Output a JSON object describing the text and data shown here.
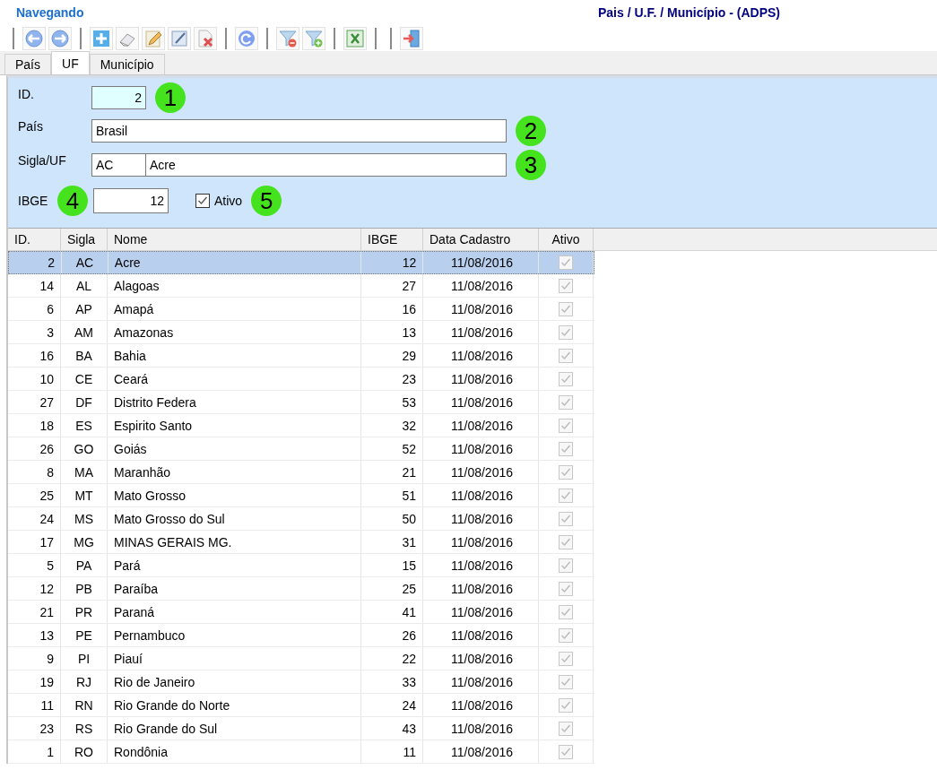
{
  "header": {
    "mode": "Navegando",
    "title": "Pais / U.F. / Município - (ADPS)"
  },
  "tabs": [
    {
      "label": "País",
      "selected": false
    },
    {
      "label": "UF",
      "selected": true
    },
    {
      "label": "Município",
      "selected": false
    }
  ],
  "form": {
    "id": {
      "label": "ID.",
      "value": "2",
      "callout": "1"
    },
    "pais": {
      "label": "País",
      "value": "Brasil",
      "callout": "2"
    },
    "sigla_uf": {
      "label": "Sigla/UF",
      "sigla": "AC",
      "name": "Acre",
      "callout": "3"
    },
    "ibge": {
      "label": "IBGE",
      "value": "12",
      "callout": "4"
    },
    "ativo": {
      "label": "Ativo",
      "checked": true,
      "callout": "5"
    }
  },
  "table": {
    "columns": [
      "ID.",
      "Sigla",
      "Nome",
      "IBGE",
      "Data Cadastro",
      "Ativo"
    ],
    "rows": [
      {
        "id": "2",
        "sigla": "AC",
        "nome": "Acre",
        "ibge": "12",
        "data": "11/08/2016",
        "ativo": true,
        "selected": true
      },
      {
        "id": "14",
        "sigla": "AL",
        "nome": "Alagoas",
        "ibge": "27",
        "data": "11/08/2016",
        "ativo": true,
        "selected": false
      },
      {
        "id": "6",
        "sigla": "AP",
        "nome": "Amapá",
        "ibge": "16",
        "data": "11/08/2016",
        "ativo": true,
        "selected": false
      },
      {
        "id": "3",
        "sigla": "AM",
        "nome": "Amazonas",
        "ibge": "13",
        "data": "11/08/2016",
        "ativo": true,
        "selected": false
      },
      {
        "id": "16",
        "sigla": "BA",
        "nome": "Bahia",
        "ibge": "29",
        "data": "11/08/2016",
        "ativo": true,
        "selected": false
      },
      {
        "id": "10",
        "sigla": "CE",
        "nome": "Ceará",
        "ibge": "23",
        "data": "11/08/2016",
        "ativo": true,
        "selected": false
      },
      {
        "id": "27",
        "sigla": "DF",
        "nome": "Distrito Federa",
        "ibge": "53",
        "data": "11/08/2016",
        "ativo": true,
        "selected": false
      },
      {
        "id": "18",
        "sigla": "ES",
        "nome": "Espirito Santo",
        "ibge": "32",
        "data": "11/08/2016",
        "ativo": true,
        "selected": false
      },
      {
        "id": "26",
        "sigla": "GO",
        "nome": "Goiás",
        "ibge": "52",
        "data": "11/08/2016",
        "ativo": true,
        "selected": false
      },
      {
        "id": "8",
        "sigla": "MA",
        "nome": "Maranhão",
        "ibge": "21",
        "data": "11/08/2016",
        "ativo": true,
        "selected": false
      },
      {
        "id": "25",
        "sigla": "MT",
        "nome": "Mato Grosso",
        "ibge": "51",
        "data": "11/08/2016",
        "ativo": true,
        "selected": false
      },
      {
        "id": "24",
        "sigla": "MS",
        "nome": "Mato Grosso do Sul",
        "ibge": "50",
        "data": "11/08/2016",
        "ativo": true,
        "selected": false
      },
      {
        "id": "17",
        "sigla": "MG",
        "nome": "MINAS GERAIS MG.",
        "ibge": "31",
        "data": "11/08/2016",
        "ativo": true,
        "selected": false
      },
      {
        "id": "5",
        "sigla": "PA",
        "nome": "Pará",
        "ibge": "15",
        "data": "11/08/2016",
        "ativo": true,
        "selected": false
      },
      {
        "id": "12",
        "sigla": "PB",
        "nome": "Paraíba",
        "ibge": "25",
        "data": "11/08/2016",
        "ativo": true,
        "selected": false
      },
      {
        "id": "21",
        "sigla": "PR",
        "nome": "Paraná",
        "ibge": "41",
        "data": "11/08/2016",
        "ativo": true,
        "selected": false
      },
      {
        "id": "13",
        "sigla": "PE",
        "nome": "Pernambuco",
        "ibge": "26",
        "data": "11/08/2016",
        "ativo": true,
        "selected": false
      },
      {
        "id": "9",
        "sigla": "PI",
        "nome": "Piauí",
        "ibge": "22",
        "data": "11/08/2016",
        "ativo": true,
        "selected": false
      },
      {
        "id": "19",
        "sigla": "RJ",
        "nome": "Rio de Janeiro",
        "ibge": "33",
        "data": "11/08/2016",
        "ativo": true,
        "selected": false
      },
      {
        "id": "11",
        "sigla": "RN",
        "nome": "Rio Grande do Norte",
        "ibge": "24",
        "data": "11/08/2016",
        "ativo": true,
        "selected": false
      },
      {
        "id": "23",
        "sigla": "RS",
        "nome": "Rio Grande do Sul",
        "ibge": "43",
        "data": "11/08/2016",
        "ativo": true,
        "selected": false
      },
      {
        "id": "1",
        "sigla": "RO",
        "nome": "Rondônia",
        "ibge": "11",
        "data": "11/08/2016",
        "ativo": true,
        "selected": false
      }
    ]
  }
}
